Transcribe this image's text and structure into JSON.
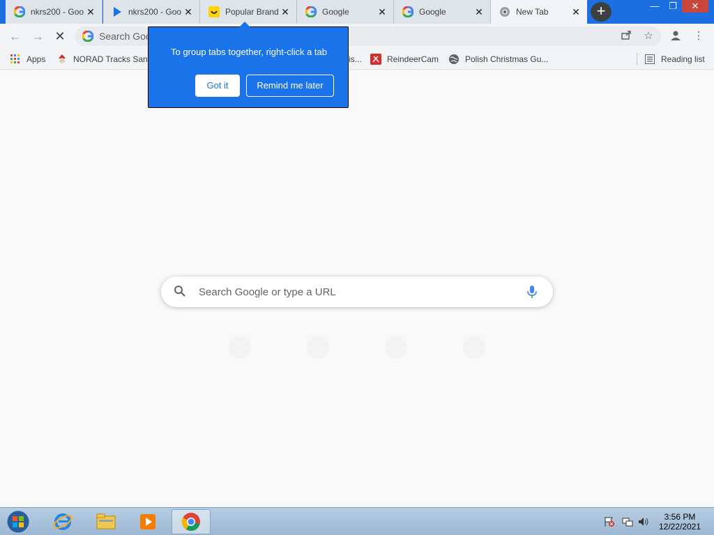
{
  "browser": {
    "tabs": [
      {
        "title": "nkrs200 - Goo",
        "icon": "google-icon",
        "active": false
      },
      {
        "title": "nkrs200 - Goo",
        "icon": "play-icon",
        "active": false
      },
      {
        "title": "Popular Brand",
        "icon": "smiley-icon",
        "active": false
      },
      {
        "title": "Google",
        "icon": "google-icon",
        "active": false
      },
      {
        "title": "Google",
        "icon": "google-icon",
        "active": false
      },
      {
        "title": "New Tab",
        "icon": "chrome-icon",
        "active": true
      }
    ],
    "close_glyph": "✕",
    "new_tab_glyph": "+",
    "window_controls": {
      "minimize": "—",
      "restore": "❐",
      "close": "✕"
    }
  },
  "toolbar": {
    "omnibox_text": "Search Goo",
    "back_glyph": "←",
    "forward_glyph": "→",
    "stop_glyph": "✕"
  },
  "bookmarks": [
    {
      "label": "Apps",
      "icon": "apps-grid-icon"
    },
    {
      "label": "NORAD Tracks Santa",
      "icon": "santa-icon"
    },
    {
      "label": "is...",
      "icon": "none"
    },
    {
      "label": "ReindeerCam",
      "icon": "reindeer-icon"
    },
    {
      "label": "Polish Christmas Gu...",
      "icon": "globe-icon"
    },
    {
      "label": "Reading list",
      "icon": "reading-list-icon"
    }
  ],
  "tooltip": {
    "text": "To group tabs together, right-click a tab",
    "got_it": "Got it",
    "remind_later": "Remind me later"
  },
  "ntp": {
    "search_placeholder": "Search Google or type a URL"
  },
  "taskbar": {
    "time": "3:56 PM",
    "date": "12/22/2021"
  },
  "colors": {
    "tab_strip": "#1b6fe0",
    "tooltip_bg": "#1a73e8",
    "mic_blue": "#4285f4"
  }
}
